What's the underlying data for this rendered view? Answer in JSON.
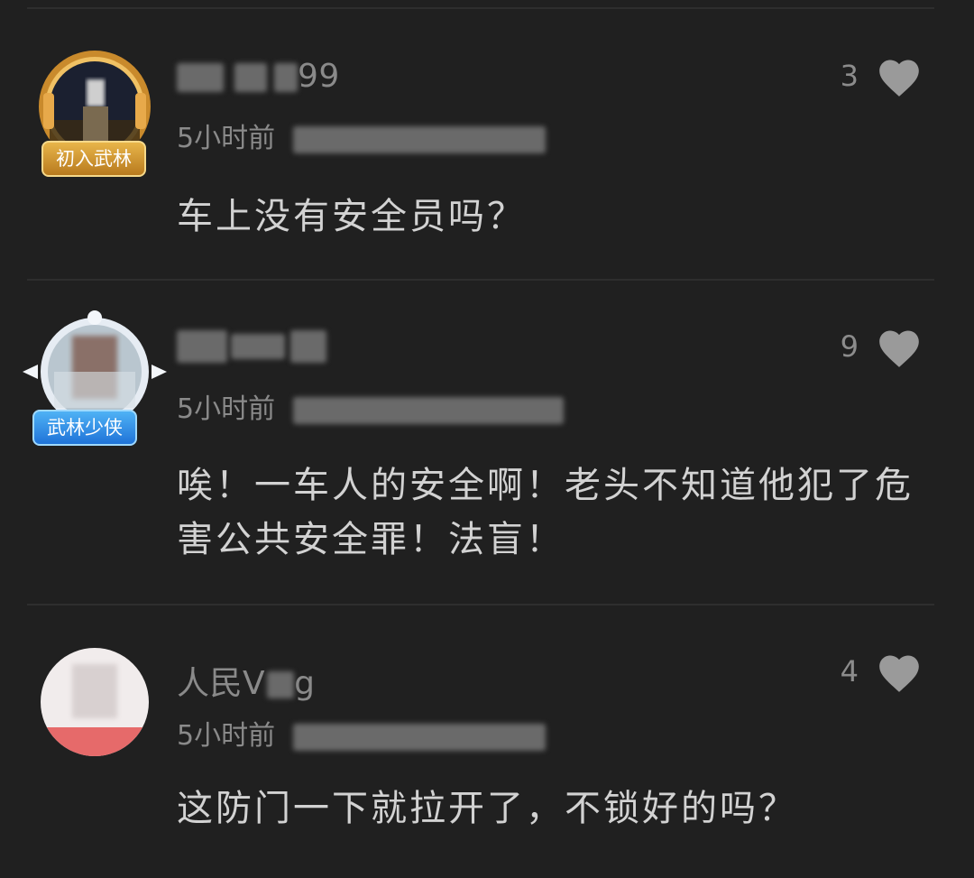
{
  "comments": [
    {
      "username_visible": "99",
      "time": "5小时前",
      "text": "车上没有安全员吗？",
      "likes": "3",
      "badge": "初入武林",
      "badge_style": "gold",
      "avatar_icon": "user-avatar-frame-gold-icon"
    },
    {
      "username_visible": "",
      "time": "5小时前",
      "text": "唉！一车人的安全啊！老头不知道他犯了危害公共安全罪！法盲！",
      "likes": "9",
      "badge": "武林少侠",
      "badge_style": "blue",
      "avatar_icon": "user-avatar-frame-silver-icon"
    },
    {
      "username_visible": "人民V",
      "username_tail": "g",
      "time": "5小时前",
      "text": "这防门一下就拉开了，不锁好的吗？",
      "likes": "4",
      "badge": "",
      "avatar_icon": "user-avatar-icon"
    }
  ],
  "colors": {
    "background": "#202020",
    "text_primary": "#d2d2d2",
    "text_secondary": "#8a8a8a",
    "heart": "#9a9a9a"
  }
}
